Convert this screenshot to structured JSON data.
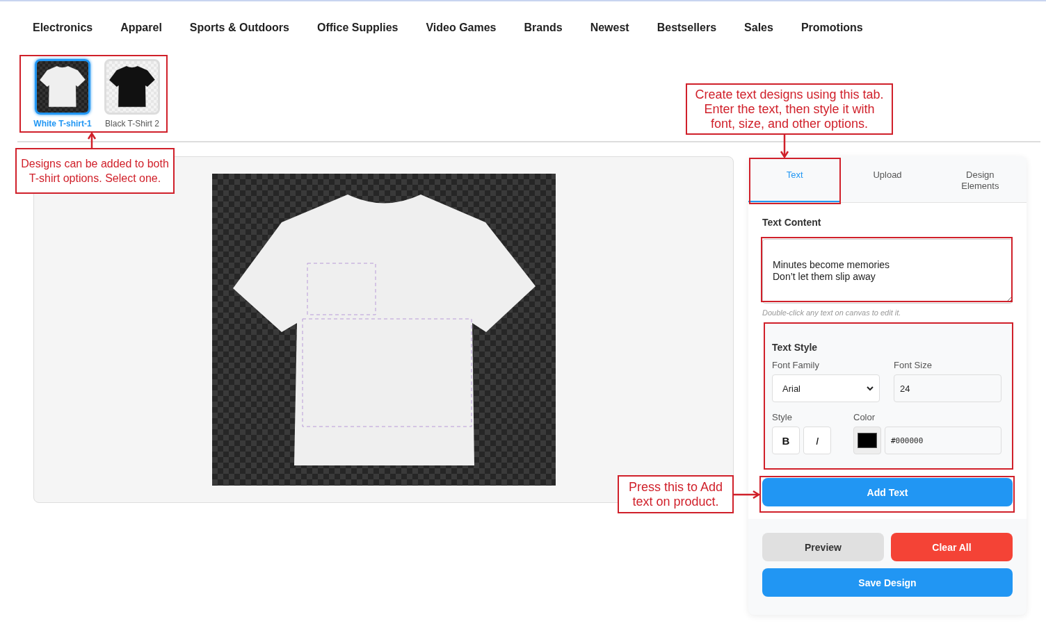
{
  "nav": [
    "Electronics",
    "Apparel",
    "Sports & Outdoors",
    "Office Supplies",
    "Video Games",
    "Brands",
    "Newest",
    "Bestsellers",
    "Sales",
    "Promotions"
  ],
  "products": [
    {
      "name": "White T-shirt-1",
      "kind": "white",
      "selected": true
    },
    {
      "name": "Black T-Shirt 2",
      "kind": "black",
      "selected": false
    }
  ],
  "tabs": [
    {
      "label": "Text",
      "selected": true
    },
    {
      "label": "Upload",
      "selected": false
    },
    {
      "label": "Design Elements",
      "selected": false
    }
  ],
  "text_content": {
    "label": "Text Content",
    "value": "Minutes become memories\nDon’t let them slip away",
    "hint": "Double-click any text on canvas to edit it."
  },
  "text_style": {
    "title": "Text Style",
    "font_family_label": "Font Family",
    "font_family": "Arial",
    "font_size_label": "Font Size",
    "font_size": "24",
    "style_label": "Style",
    "bold": "B",
    "italic": "I",
    "color_label": "Color",
    "color": "#000000"
  },
  "buttons": [
    {
      "label": "Add Text",
      "kind": "primary"
    },
    {
      "label": "Preview",
      "kind": "secondary"
    },
    {
      "label": "Clear All",
      "kind": "danger"
    },
    {
      "label": "Save Design",
      "kind": "primary"
    }
  ],
  "annotations": [
    {
      "text": "Designs can be added to both T-shirt options. Select one."
    },
    {
      "text": "Create text designs using this tab. Enter the text, then style it with font, size, and other options."
    },
    {
      "text": "Press this to Add text on product."
    }
  ]
}
